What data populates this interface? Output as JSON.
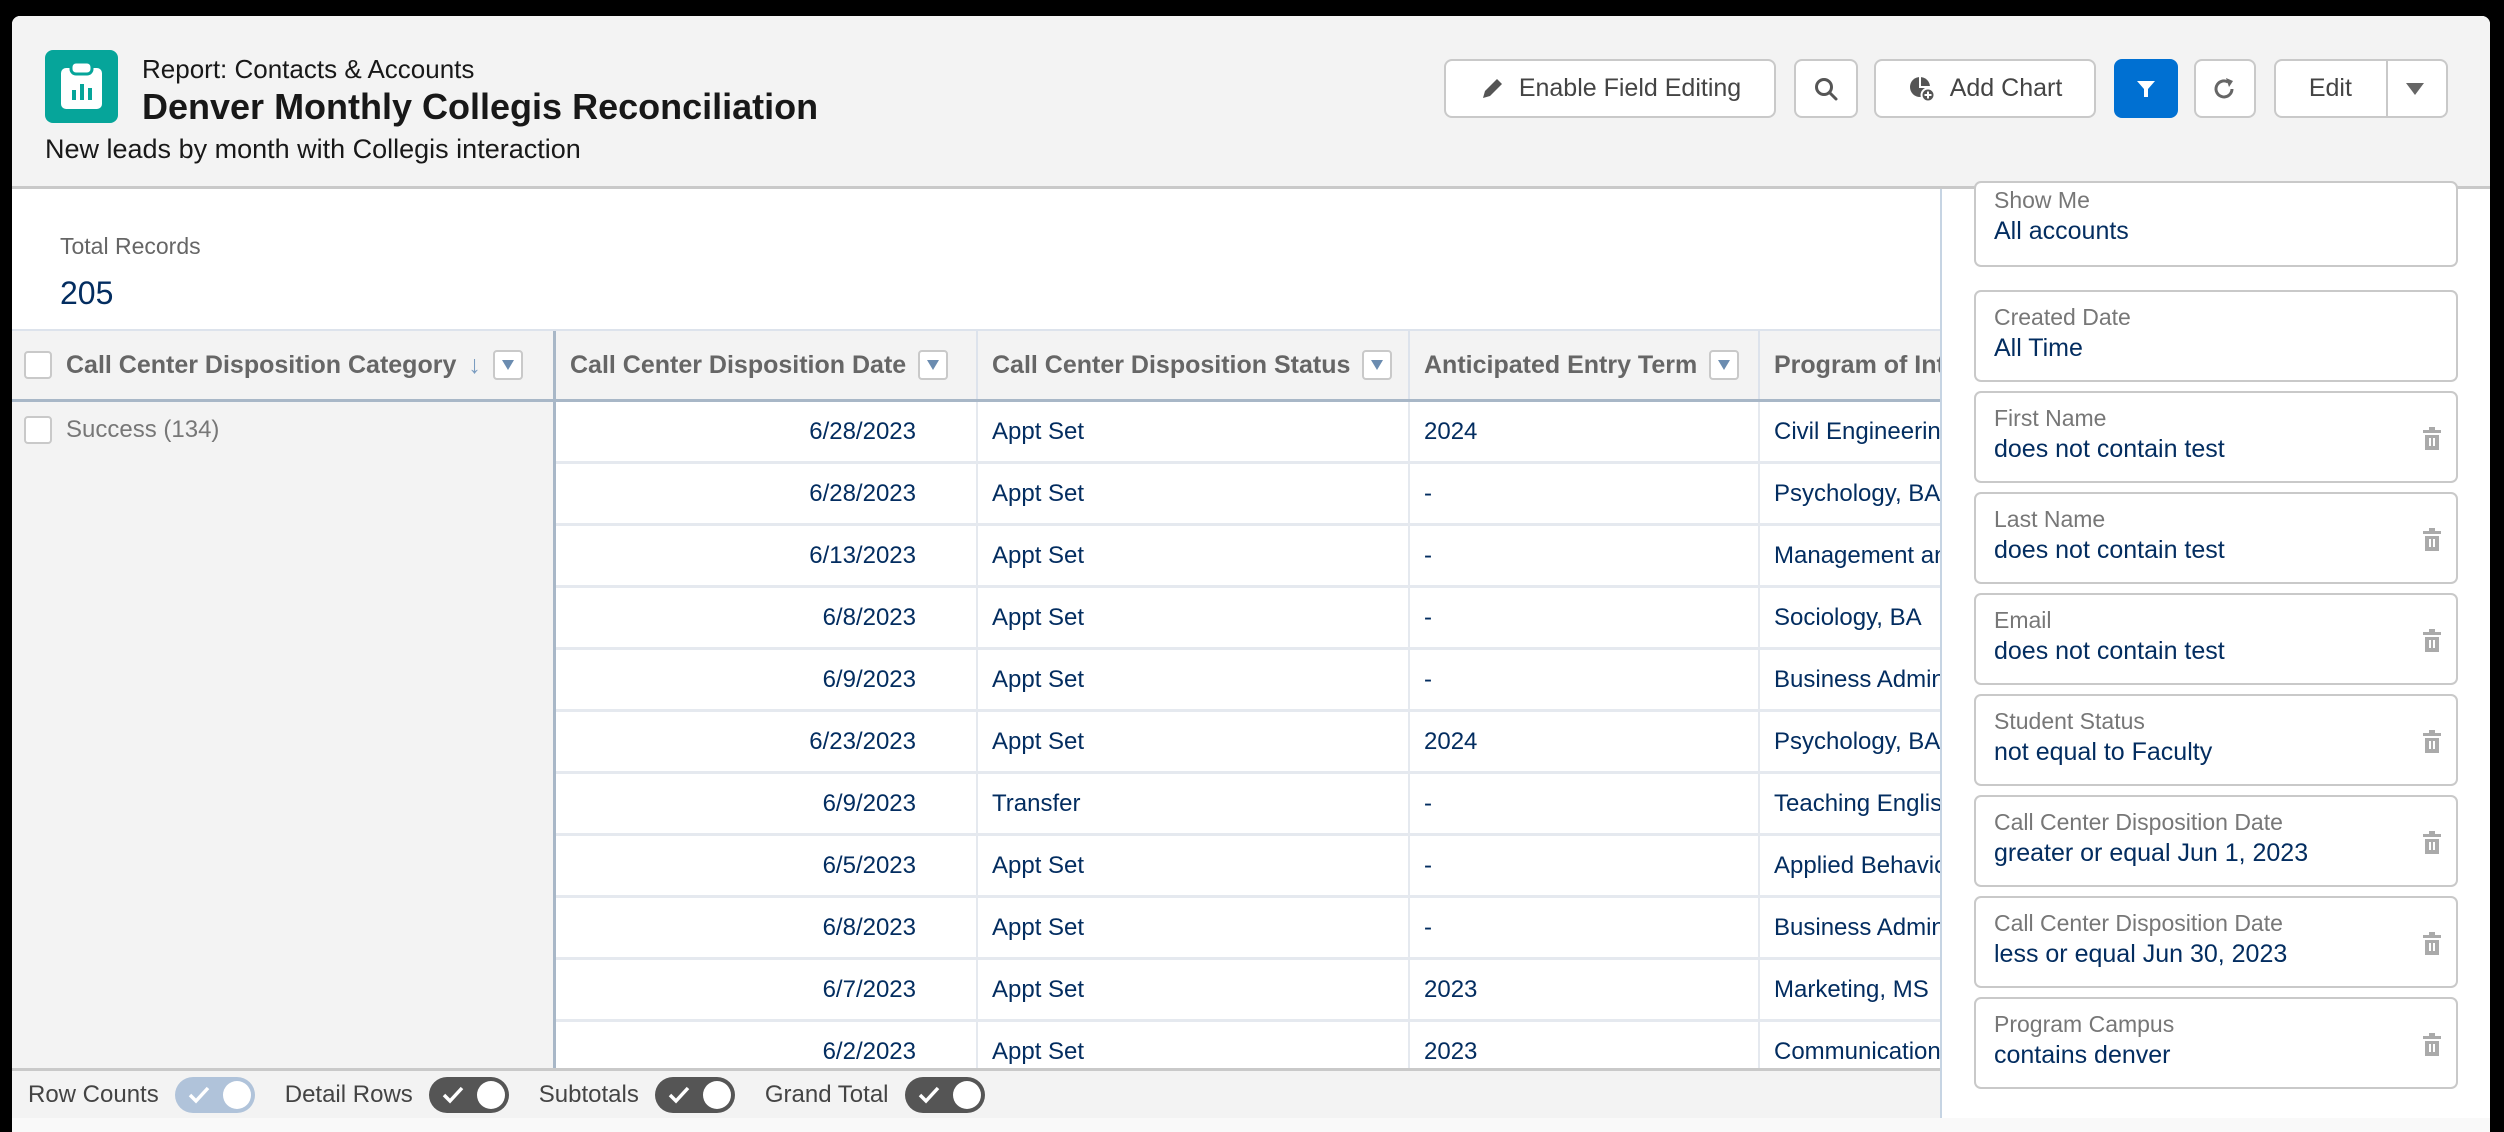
{
  "header": {
    "eyebrow": "Report: Contacts & Accounts",
    "title": "Denver Monthly Collegis Reconciliation",
    "subtitle": "New leads by month with Collegis interaction",
    "icon": "report-icon",
    "icon_color": "#06a59a"
  },
  "toolbar": {
    "enable_field_editing": "Enable Field Editing",
    "add_chart": "Add Chart",
    "edit": "Edit",
    "filter_active_color": "#0070d2"
  },
  "summary": {
    "total_records_label": "Total Records",
    "total_records_value": "205"
  },
  "table": {
    "columns": [
      {
        "label": "Call Center Disposition Category",
        "sorted": "descending"
      },
      {
        "label": "Call Center Disposition Date"
      },
      {
        "label": "Call Center Disposition Status"
      },
      {
        "label": "Anticipated Entry Term"
      },
      {
        "label": "Program of Inte"
      }
    ],
    "group": {
      "label": "Success",
      "count": "(134)"
    },
    "rows": [
      {
        "date": "6/28/2023",
        "status": "Appt Set",
        "term": "2024",
        "program": "Civil Engineering"
      },
      {
        "date": "6/28/2023",
        "status": "Appt Set",
        "term": "-",
        "program": "Psychology, BA"
      },
      {
        "date": "6/13/2023",
        "status": "Appt Set",
        "term": "-",
        "program": "Management an"
      },
      {
        "date": "6/8/2023",
        "status": "Appt Set",
        "term": "-",
        "program": "Sociology, BA"
      },
      {
        "date": "6/9/2023",
        "status": "Appt Set",
        "term": "-",
        "program": "Business Admin"
      },
      {
        "date": "6/23/2023",
        "status": "Appt Set",
        "term": "2024",
        "program": "Psychology, BA"
      },
      {
        "date": "6/9/2023",
        "status": "Transfer",
        "term": "-",
        "program": "Teaching English"
      },
      {
        "date": "6/5/2023",
        "status": "Appt Set",
        "term": "-",
        "program": "Applied Behavio"
      },
      {
        "date": "6/8/2023",
        "status": "Appt Set",
        "term": "-",
        "program": "Business Admin"
      },
      {
        "date": "6/7/2023",
        "status": "Appt Set",
        "term": "2023",
        "program": "Marketing, MS"
      },
      {
        "date": "6/2/2023",
        "status": "Appt Set",
        "term": "2023",
        "program": "Communication,"
      }
    ]
  },
  "filters": [
    {
      "label": "Show Me",
      "value": "All accounts",
      "removable": false
    },
    {
      "label": "Created Date",
      "value": "All Time",
      "removable": false
    },
    {
      "label": "First Name",
      "value": "does not contain test",
      "removable": true
    },
    {
      "label": "Last Name",
      "value": "does not contain test",
      "removable": true
    },
    {
      "label": "Email",
      "value": "does not contain test",
      "removable": true
    },
    {
      "label": "Student Status",
      "value": "not equal to Faculty",
      "removable": true
    },
    {
      "label": "Call Center Disposition Date",
      "value": "greater or equal Jun 1, 2023",
      "removable": true
    },
    {
      "label": "Call Center Disposition Date",
      "value": "less or equal Jun 30, 2023",
      "removable": true
    },
    {
      "label": "Program Campus",
      "value": "contains denver",
      "removable": true
    }
  ],
  "footer": {
    "toggles": [
      {
        "label": "Row Counts",
        "on": true,
        "disabled": true
      },
      {
        "label": "Detail Rows",
        "on": true,
        "disabled": false
      },
      {
        "label": "Subtotals",
        "on": true,
        "disabled": false
      },
      {
        "label": "Grand Total",
        "on": true,
        "disabled": false
      }
    ]
  }
}
